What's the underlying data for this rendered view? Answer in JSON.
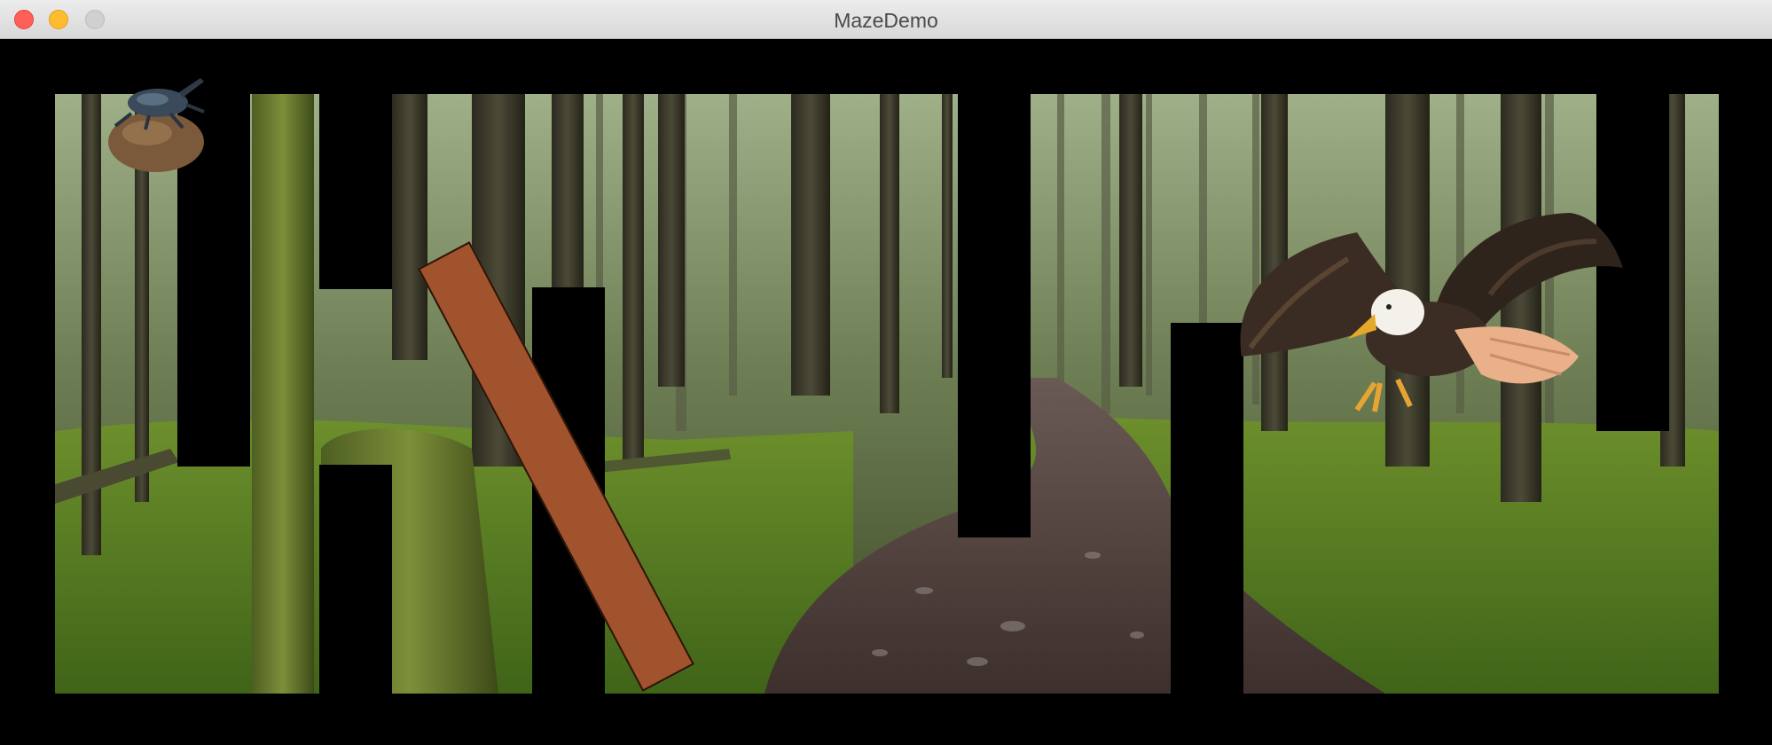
{
  "window": {
    "title": "MazeDemo",
    "buttons": [
      "close",
      "minimize",
      "zoom"
    ]
  },
  "scene": {
    "background": "forest-path",
    "colors": {
      "wall": "#000000",
      "obstacle": "#a0532d",
      "canvas": "#000000"
    },
    "player": "beetle-on-ball",
    "enemy": "bald-eagle",
    "obstacle_angle_deg": -28
  }
}
